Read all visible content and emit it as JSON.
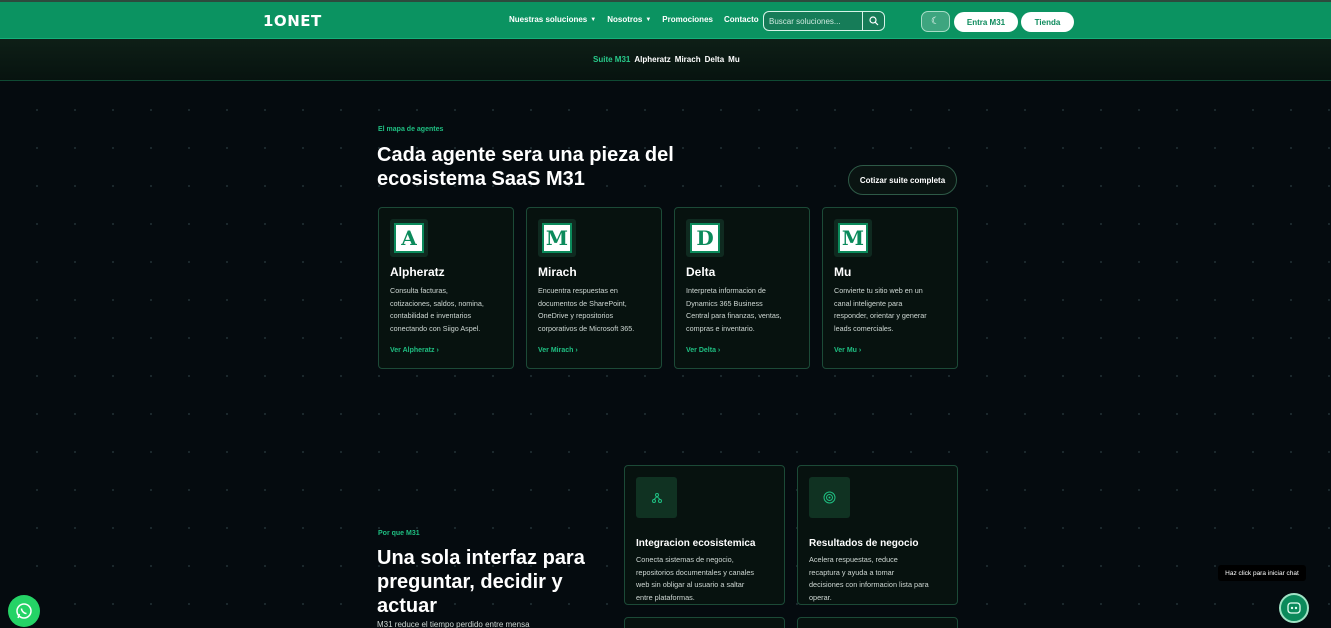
{
  "header": {
    "logo": "1ONET",
    "nav": [
      {
        "label": "Nuestras soluciones",
        "caret": true
      },
      {
        "label": "Nosotros",
        "caret": true
      },
      {
        "label": "Promociones",
        "caret": false
      },
      {
        "label": "Contacto",
        "caret": false
      }
    ],
    "search_placeholder": "Buscar soluciones...",
    "login_label": "Entra M31",
    "store_label": "Tienda"
  },
  "subnav": {
    "items": [
      "Suite M31",
      "Alpheratz",
      "Mirach",
      "Delta",
      "Mu"
    ],
    "active": "Suite M31"
  },
  "agents": {
    "eyebrow": "El mapa de agentes",
    "title_line1": "Cada agente sera una pieza del",
    "title_line2": "ecosistema SaaS M31",
    "cta": "Cotizar suite completa",
    "cards": [
      {
        "name": "Alpheratz",
        "icon": "alpheratz-logo-icon",
        "letter": "A",
        "desc": [
          "Consulta facturas,",
          "cotizaciones, saldos, nomina,",
          "contabilidad e inventarios",
          "conectando con Siigo Aspel."
        ],
        "link": "Ver Alpheratz"
      },
      {
        "name": "Mirach",
        "icon": "mirach-logo-icon",
        "letter": "M",
        "desc": [
          "Encuentra respuestas en",
          "documentos de SharePoint,",
          "OneDrive y repositorios",
          "corporativos de Microsoft 365."
        ],
        "link": "Ver Mirach"
      },
      {
        "name": "Delta",
        "icon": "delta-logo-icon",
        "letter": "D",
        "desc": [
          "Interpreta informacion de",
          "Dynamics 365 Business",
          "Central para finanzas, ventas,",
          "compras e inventario."
        ],
        "link": "Ver Delta"
      },
      {
        "name": "Mu",
        "icon": "mu-logo-icon",
        "letter": "M",
        "desc": [
          "Convierte tu sitio web en un",
          "canal inteligente para",
          "responder, orientar y generar",
          "leads comerciales."
        ],
        "link": "Ver Mu"
      }
    ]
  },
  "why": {
    "eyebrow": "Por que M31",
    "title_line1": "Una sola interfaz para",
    "title_line2": "preguntar, decidir y",
    "title_line3": "actuar",
    "paragraph": "M31 reduce el tiempo perdido entre mensa",
    "features": [
      {
        "title": "Integracion ecosistemica",
        "icon": "network-icon",
        "desc": [
          "Conecta sistemas de negocio,",
          "repositorios documentales y canales",
          "web sin obligar al usuario a saltar",
          "entre plataformas."
        ]
      },
      {
        "title": "Resultados de negocio",
        "icon": "target-icon",
        "desc": [
          "Acelera respuestas, reduce",
          "recaptura y ayuda a tomar",
          "decisiones con informacion lista para",
          "operar."
        ]
      }
    ]
  },
  "chat": {
    "tooltip": "Haz click para iniciar chat"
  }
}
